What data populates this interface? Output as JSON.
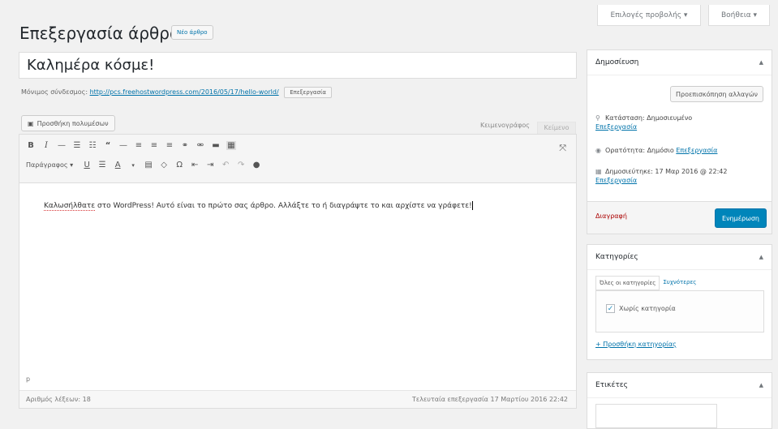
{
  "topbar": {
    "screen_options": "Επιλογές προβολής ▾",
    "help": "Βοήθεια ▾"
  },
  "header": {
    "title": "Επεξεργασία άρθρου",
    "new_post": "Νέο άρθρο"
  },
  "post": {
    "title": "Καλημέρα κόσμε!",
    "permalink_label": "Μόνιμος σύνδεσμος:",
    "permalink_url": "http://pcs.freehostwordpress.com/2016/05/17/hello-world/",
    "permalink_edit": "Επεξεργασία"
  },
  "editor": {
    "add_media": "Προσθήκη πολυμέσων",
    "tab_visual": "Κειμενογράφος",
    "tab_text": "Κείμενο",
    "format_select": "Παράγραφος ▾",
    "content_word1": "Καλωσήλθατε",
    "content_rest": " στο WordPress! Αυτό είναι το πρώτο σας άρθρο. Αλλάξτε το ή διαγράψτε το και αρχίστε να γράφετε!",
    "path": "p",
    "word_count": "Αριθμός λέξεων: 18",
    "last_edited": "Τελευταία επεξεργασία 17 Μαρτίου 2016 22:42"
  },
  "publish_box": {
    "title": "Δημοσίευση",
    "preview": "Προεπισκόπηση αλλαγών",
    "status_label": "Κατάσταση: Δημοσιευμένο",
    "status_edit": "Επεξεργασία",
    "visibility_label": "Ορατότητα: Δημόσιο",
    "visibility_edit": "Επεξεργασία",
    "published_label": "Δημοσιεύτηκε: 17 Μαρ 2016 @ 22:42",
    "published_edit": "Επεξεργασία",
    "delete": "Διαγραφή",
    "update": "Ενημέρωση"
  },
  "categories_box": {
    "title": "Κατηγορίες",
    "tab_all": "Όλες οι κατηγορίες",
    "tab_popular": "Συχνότερες",
    "item": "Χωρίς κατηγορία",
    "add_new": "+ Προσθήκη κατηγορίας"
  },
  "tags_box": {
    "title": "Ετικέτες"
  },
  "icons": {
    "collapse": "▲",
    "media": "▣",
    "expand": "⤧",
    "status": "📍",
    "visibility": "◉",
    "calendar": "▦"
  }
}
